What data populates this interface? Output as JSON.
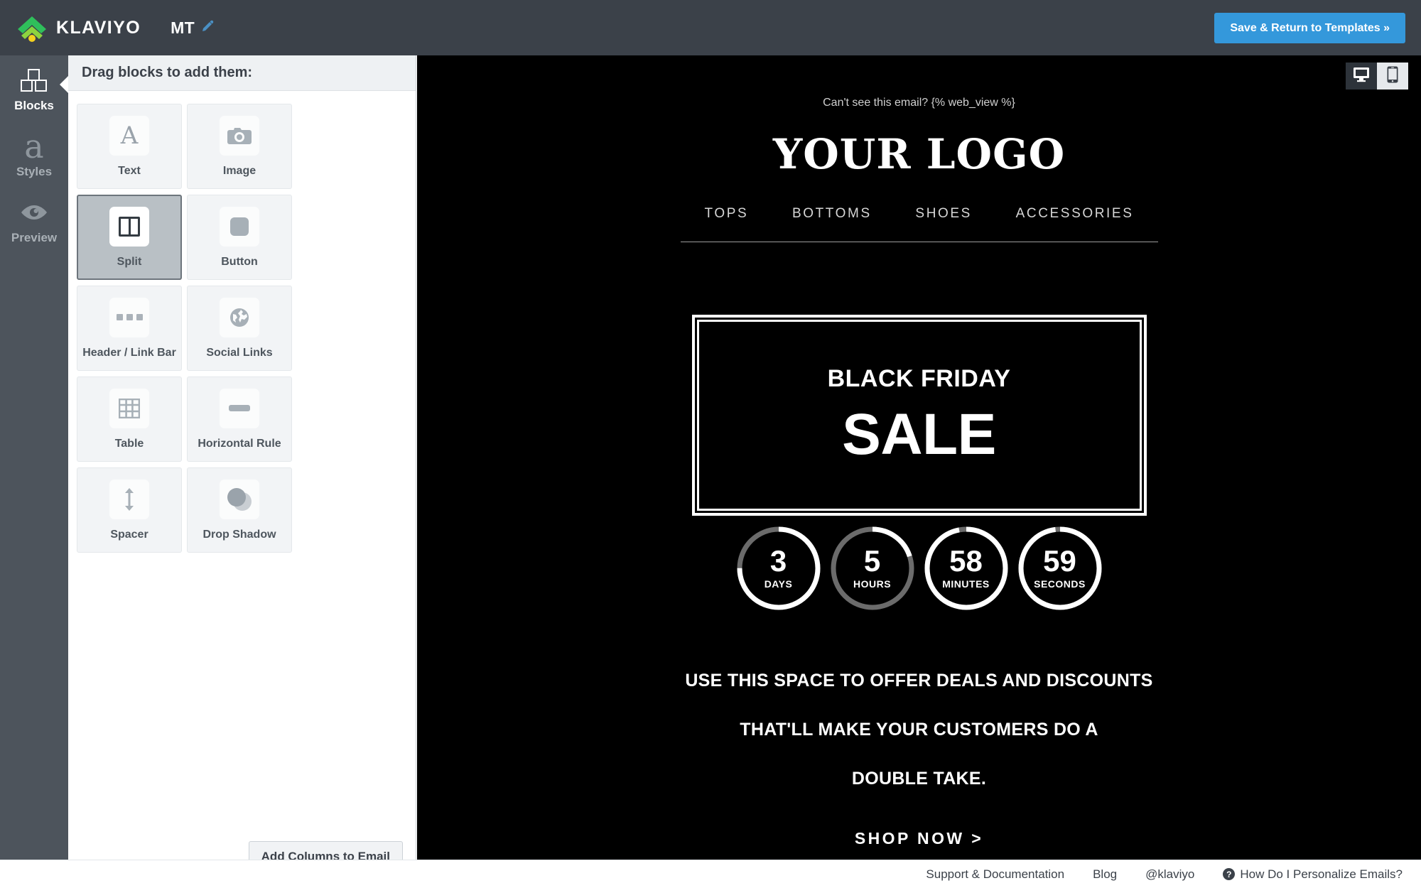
{
  "topbar": {
    "logo_icon": "klaviyo-wifi-logo",
    "brand_name": "KLAVIYO",
    "template_name": "MT",
    "edit_icon": "pencil-icon",
    "save_label": "Save & Return to Templates »",
    "accent_blue": "#3498db",
    "bar_bg": "#3b4149"
  },
  "rail": {
    "items": [
      {
        "label": "Blocks",
        "icon": "blocks-icon",
        "active": true
      },
      {
        "label": "Styles",
        "icon": "letter-a-icon",
        "active": false
      },
      {
        "label": "Preview",
        "icon": "eye-icon",
        "active": false
      }
    ]
  },
  "panel": {
    "title": "Drag blocks to add them:",
    "blocks": [
      {
        "label": "Text",
        "icon": "text-icon",
        "selected": false
      },
      {
        "label": "Image",
        "icon": "camera-icon",
        "selected": false
      },
      {
        "label": "Split",
        "icon": "split-columns-icon",
        "selected": true
      },
      {
        "label": "Button",
        "icon": "button-icon",
        "selected": false
      },
      {
        "label": "Header / Link Bar",
        "icon": "three-dots-icon",
        "selected": false
      },
      {
        "label": "Social Links",
        "icon": "globe-icon",
        "selected": false
      },
      {
        "label": "Table",
        "icon": "table-grid-icon",
        "selected": false
      },
      {
        "label": "Horizontal Rule",
        "icon": "horizontal-rule-icon",
        "selected": false
      },
      {
        "label": "Spacer",
        "icon": "vertical-arrows-icon",
        "selected": false
      },
      {
        "label": "Drop Shadow",
        "icon": "drop-shadow-icon",
        "selected": false
      }
    ],
    "add_columns_label": "Add Columns to Email"
  },
  "stage": {
    "device_toggle": [
      {
        "name": "desktop-view",
        "icon": "monitor-icon",
        "active": true
      },
      {
        "name": "mobile-view",
        "icon": "phone-icon",
        "active": false
      }
    ]
  },
  "email": {
    "background": "#000000",
    "webview_text": "Can't see this email? {% web_view %}",
    "logo_text": "YOUR LOGO",
    "nav": [
      "TOPS",
      "BOTTOMS",
      "SHOES",
      "ACCESSORIES"
    ],
    "hero": {
      "kicker": "BLACK FRIDAY",
      "headline": "SALE"
    },
    "countdown": [
      {
        "value": "3",
        "unit": "DAYS",
        "percent": 75
      },
      {
        "value": "5",
        "unit": "HOURS",
        "percent": 20
      },
      {
        "value": "58",
        "unit": "MINUTES",
        "percent": 97
      },
      {
        "value": "59",
        "unit": "SECONDS",
        "percent": 98
      }
    ],
    "body_lines": [
      "USE THIS SPACE TO OFFER DEALS AND DISCOUNTS",
      "THAT'LL MAKE YOUR CUSTOMERS DO A",
      "DOUBLE TAKE."
    ],
    "cta": "SHOP NOW >"
  },
  "footer": {
    "links": [
      "Support & Documentation",
      "Blog",
      "@klaviyo"
    ],
    "help_glyph": "?",
    "help_label": "How Do I Personalize Emails?"
  }
}
